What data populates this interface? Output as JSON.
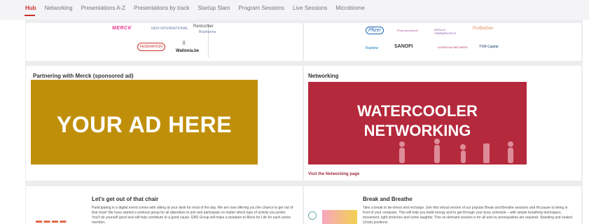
{
  "nav": {
    "tabs": [
      "Hub",
      "Networking",
      "Presentations A-Z",
      "Presentations by track",
      "Startup Slam",
      "Program Sessions",
      "Live Sessions",
      "Microbiome"
    ],
    "active_tab": "Hub",
    "accent": "#d0302a"
  },
  "sponsors_left": {
    "merck": "MERCK",
    "new_international": "NEW INTERNATIONAL",
    "rentschler": "Rentschler",
    "rentschler_sub": "Biopharma",
    "fed": "FEDERATION",
    "wallonia": "Wallonia.be"
  },
  "sponsors_right": {
    "pfizer": "Pfizer",
    "pharma": "PharmaVentures",
    "apollo": "APOLLO THERAPEUTICS",
    "probiogen": "ProBioGen",
    "raybow": "Raybow",
    "sanofi": "SANOFI",
    "sofinova": "SOFINOVA PARTNERS",
    "tvm": "TVM Capital"
  },
  "partnering": {
    "title": "Partnering with Merck (sponsored ad)",
    "ad_text": "YOUR AD HERE",
    "ad_color": "#c08f0a"
  },
  "networking": {
    "title": "Networking",
    "banner_line1": "WATERCOOLER",
    "banner_line2": "NETWORKING",
    "banner_color": "#b5293c",
    "link": "Visit the Networking page"
  },
  "chair": {
    "title": "Let's get out of that chair",
    "body": "Participating in a digital event comes with sitting at your desk for most of the day. We are now offering you the chance to get out of that chair! We have started a workout group for all attendees to join and participate no matter which type of activity you prefer. You'll do yourself good and will help contribute to a good cause. EBD Group will make a donation to Move for Life for each active member."
  },
  "break": {
    "title": "Break and Breathe",
    "body": "Take a break to de-stress and recharge. Join this virtual version of our popular Break and Breathe sessions and hit pause to being in front of your computer. This will help you build energy and to get through your busy schedule – with simple breathing techniques, movement, light stretches and some laughter. This on-demand session is for all and no prerequisites are required. Standing and seated (chair) positions."
  }
}
